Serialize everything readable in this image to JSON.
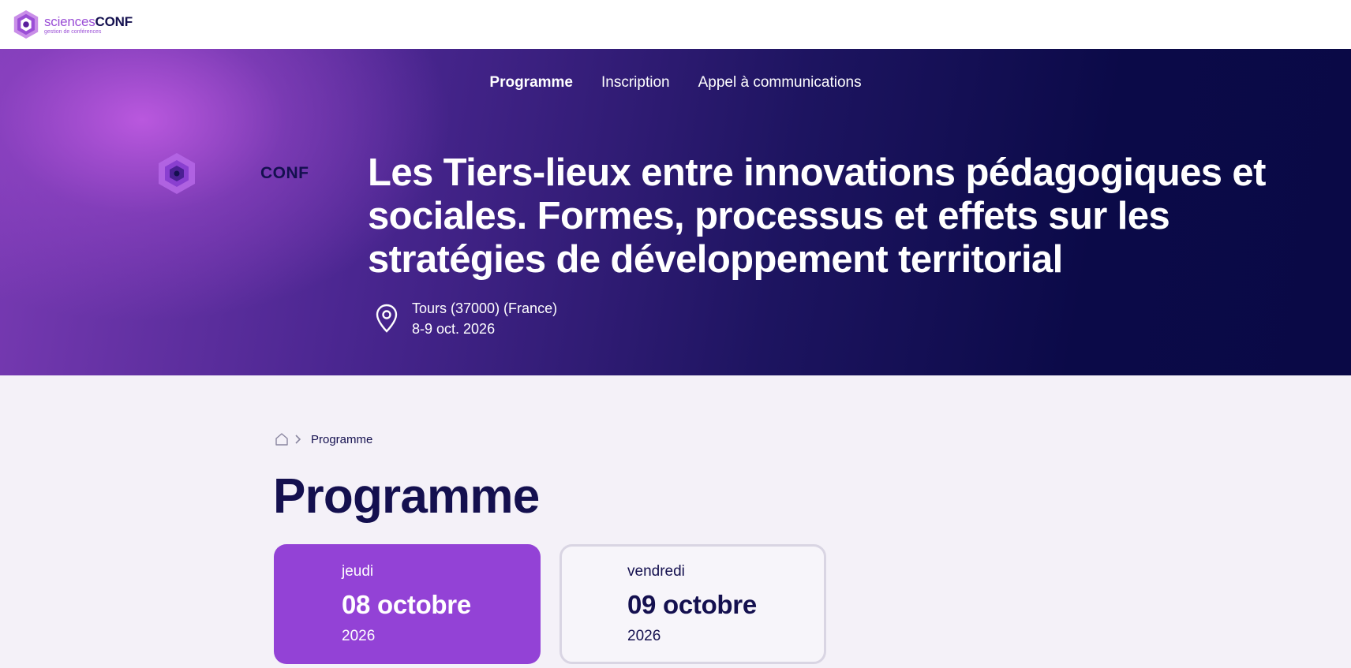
{
  "brand": {
    "name_light": "sciences",
    "name_bold": "CONF",
    "tagline": "gestion de conférences"
  },
  "nav": {
    "items": [
      {
        "label": "Programme",
        "active": true
      },
      {
        "label": "Inscription",
        "active": false
      },
      {
        "label": "Appel à communications",
        "active": false
      }
    ]
  },
  "hero": {
    "logo_text": "CONF",
    "title": "Les Tiers-lieux entre innovations pédagogiques et sociales. Formes, processus et effets sur les stratégies de développement territorial",
    "location": "Tours (37000) (France)",
    "dates": "8-9 oct. 2026",
    "location_icon": "map-pin-icon"
  },
  "breadcrumb": {
    "home_icon": "home-icon",
    "separator_icon": "chevron-right-icon",
    "current": "Programme"
  },
  "page": {
    "title": "Programme"
  },
  "days": [
    {
      "weekday": "jeudi",
      "date": "08 octobre",
      "year": "2026",
      "selected": true
    },
    {
      "weekday": "vendredi",
      "date": "09 octobre",
      "year": "2026",
      "selected": false
    }
  ],
  "colors": {
    "accent": "#9342d6",
    "navy": "#14104f",
    "page_bg": "#f4f1f8"
  }
}
